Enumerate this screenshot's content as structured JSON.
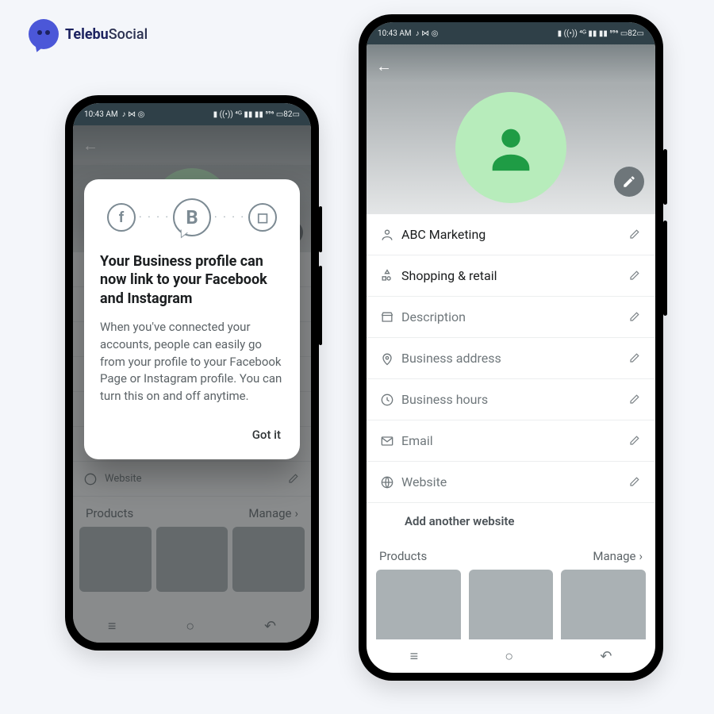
{
  "brand": {
    "name_a": "Telebu",
    "name_b": "Social"
  },
  "statusbar": {
    "time": "10:43 AM",
    "icons_left": "♪ ⋈ ◎",
    "icons_right": "▮ ((•)) ⁴ᴳ ▮▮ ▮▮ ⁵⁹⁶ ▭82▭"
  },
  "profile": {
    "rows": [
      {
        "id": "name",
        "label": "ABC Marketing",
        "placeholder": false,
        "icon": "person"
      },
      {
        "id": "category",
        "label": "Shopping & retail",
        "placeholder": false,
        "icon": "category"
      },
      {
        "id": "desc",
        "label": "Description",
        "placeholder": true,
        "icon": "store"
      },
      {
        "id": "address",
        "label": "Business address",
        "placeholder": true,
        "icon": "pin"
      },
      {
        "id": "hours",
        "label": "Business hours",
        "placeholder": true,
        "icon": "clock"
      },
      {
        "id": "email",
        "label": "Email",
        "placeholder": true,
        "icon": "mail"
      },
      {
        "id": "website",
        "label": "Website",
        "placeholder": true,
        "icon": "globe"
      }
    ],
    "add_website": "Add another website",
    "products_title": "Products",
    "manage": "Manage"
  },
  "modal": {
    "title": "Your Business profile can now link to your Facebook and Instagram",
    "body": "When you've connected your accounts, people can easily go from your profile to your Facebook Page or Instagram profile. You can turn this on and off anytime.",
    "confirm": "Got it",
    "fb": "f",
    "biz": "B",
    "ig": "◻"
  },
  "nav": {
    "menu": "≡",
    "home": "○",
    "back": "↶"
  }
}
